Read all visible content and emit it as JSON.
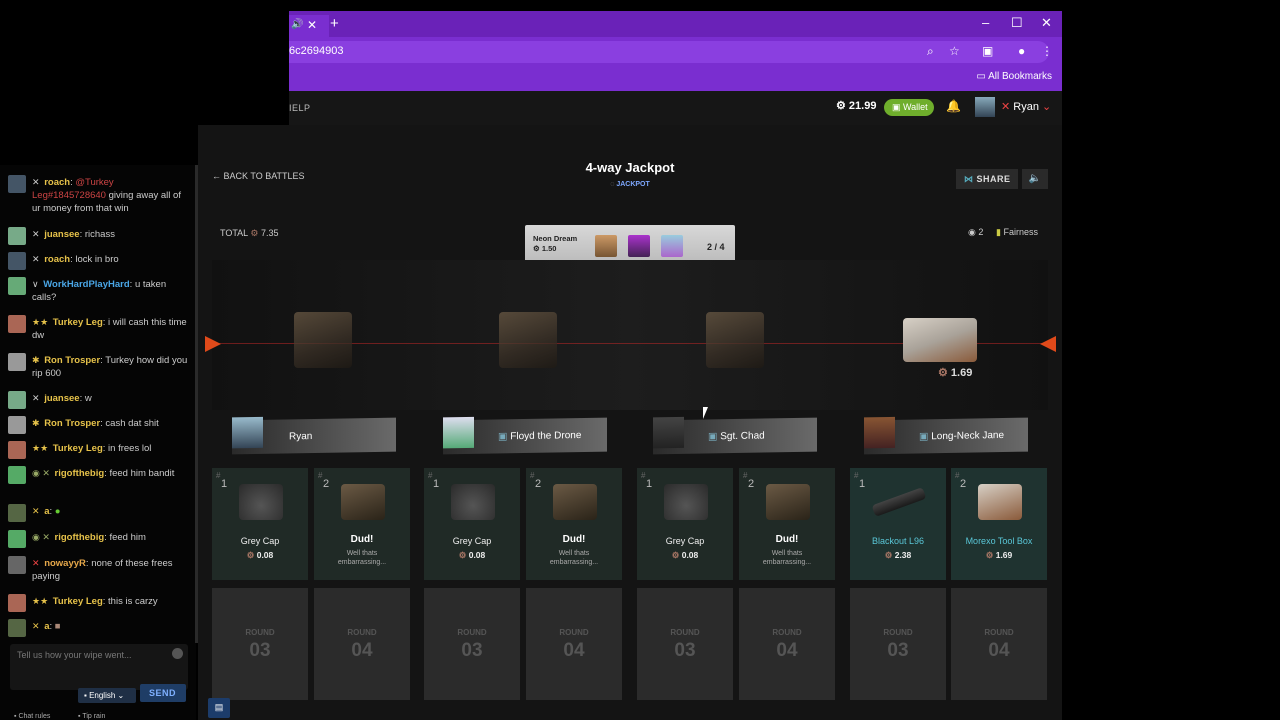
{
  "browser": {
    "tab_close": "✕",
    "new_tab": "+",
    "url": "6c2694903",
    "bookmarks": "All Bookmarks"
  },
  "site_header": {
    "help": "IELP",
    "balance": "21.99",
    "wallet": "Wallet",
    "username": "Ryan"
  },
  "chat": {
    "messages": [
      {
        "name": "roach",
        "mention": "@Turkey Leg#1845728640",
        "text": "giving away all of ur money from that win"
      },
      {
        "name": "juansee",
        "text": "richass"
      },
      {
        "name": "roach",
        "text": "lock in bro"
      },
      {
        "name": "WorkHardPlayHard",
        "text": "u taken calls?"
      },
      {
        "name": "Turkey Leg",
        "text": "i will cash this time dw"
      },
      {
        "name": "Ron Trosper",
        "text": "Turkey how did you rip 600"
      },
      {
        "name": "juansee",
        "text": "w"
      },
      {
        "name": "Ron Trosper",
        "text": "cash dat shit"
      },
      {
        "name": "Turkey Leg",
        "text": "in frees lol"
      },
      {
        "name": "rigofthebig",
        "text": "feed him bandit"
      },
      {
        "name": "a",
        "text": ""
      },
      {
        "name": "rigofthebig",
        "text": "feed him"
      },
      {
        "name": "nowayyR",
        "text": "none of these frees paying"
      },
      {
        "name": "Turkey Leg",
        "text": "this is carzy"
      },
      {
        "name": "a",
        "text": ""
      }
    ],
    "placeholder": "Tell us how your wipe went...",
    "language": "English",
    "send": "SEND",
    "chat_rules": "Chat rules",
    "tip_rain": "Tip rain"
  },
  "battle": {
    "back": "BACK TO BATTLES",
    "title": "4-way Jackpot",
    "mode": "JACKPOT",
    "share": "SHARE",
    "total_label": "TOTAL",
    "total_value": "7.35",
    "viewers": "2",
    "fairness": "Fairness",
    "case_name": "Neon Dream",
    "case_price": "1.50",
    "round_count": "2 / 4",
    "win_value": "1.69",
    "players": [
      {
        "name": "Ryan"
      },
      {
        "name": "Floyd the Drone"
      },
      {
        "name": "Sgt. Chad"
      },
      {
        "name": "Long-Neck Jane"
      }
    ],
    "items": [
      {
        "pos": "1",
        "name": "Grey Cap",
        "value": "0.08"
      },
      {
        "pos": "2",
        "name": "Dud!",
        "value": "Well thats embarrassing..."
      },
      {
        "pos": "1",
        "name": "Grey Cap",
        "value": "0.08"
      },
      {
        "pos": "2",
        "name": "Dud!",
        "value": "Well thats embarrassing..."
      },
      {
        "pos": "1",
        "name": "Grey Cap",
        "value": "0.08"
      },
      {
        "pos": "2",
        "name": "Dud!",
        "value": "Well thats embarrassing..."
      },
      {
        "pos": "1",
        "name": "Blackout L96",
        "value": "2.38"
      },
      {
        "pos": "2",
        "name": "Morexo Tool Box",
        "value": "1.69"
      }
    ],
    "round_label": "ROUND",
    "rounds": [
      "03",
      "04",
      "03",
      "04",
      "03",
      "04",
      "03",
      "04"
    ]
  }
}
